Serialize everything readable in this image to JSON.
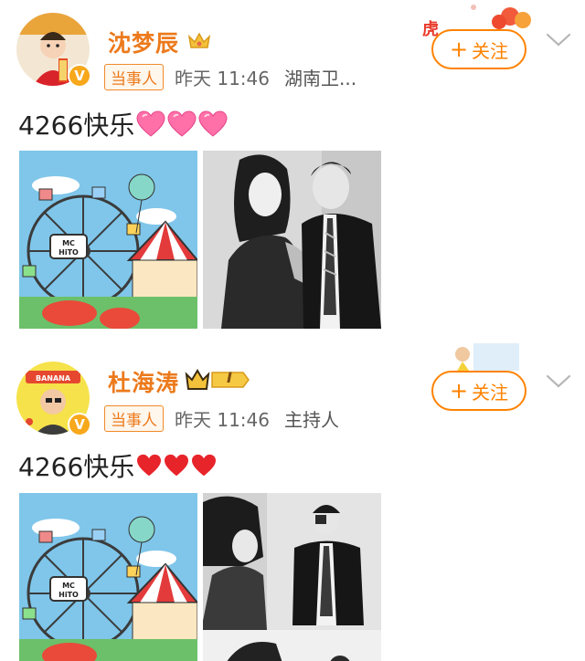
{
  "posts": [
    {
      "username": "沈梦辰",
      "tag": "当事人",
      "time": "昨天 11:46",
      "source": "湖南卫...",
      "follow_label": "关注",
      "content": "4266快乐",
      "hearts": "pink",
      "images": [
        "carnival-illustration",
        "black-white-couple-photo"
      ]
    },
    {
      "username": "杜海涛",
      "tag": "当事人",
      "time": "昨天 11:46",
      "source": "主持人",
      "follow_label": "关注",
      "content": "4266快乐",
      "hearts": "red",
      "level": "I",
      "images": [
        "carnival-illustration",
        "black-white-couple-photo"
      ]
    }
  ],
  "colors": {
    "accent": "#ff8200",
    "username": "#ec7a1c",
    "pink_heart": "#ff6fa8",
    "red_heart": "#e8242b"
  }
}
